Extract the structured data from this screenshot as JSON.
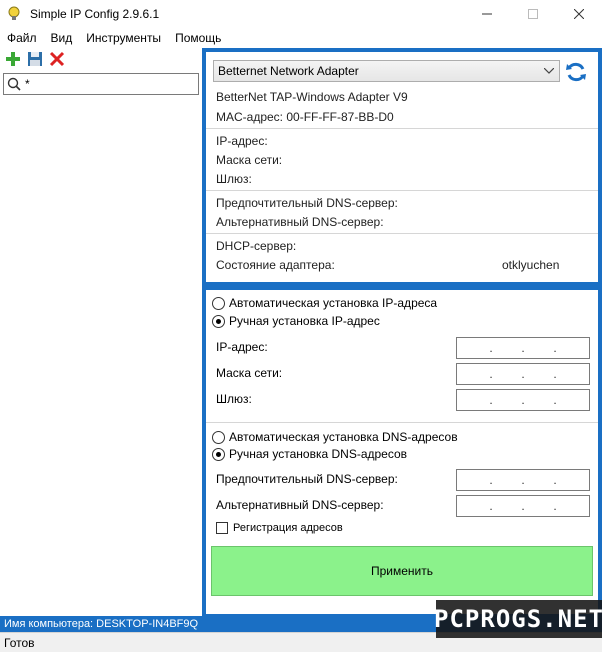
{
  "window": {
    "title": "Simple IP Config 2.9.6.1"
  },
  "menu": [
    "Файл",
    "Вид",
    "Инструменты",
    "Помощь"
  ],
  "search": {
    "value": "*"
  },
  "adapter": {
    "selected": "Betternet Network Adapter",
    "description": "BetterNet TAP-Windows Adapter V9",
    "mac": "MAC-адрес: 00-FF-FF-87-BB-D0"
  },
  "info": {
    "ip_label": "IP-адрес:",
    "mask_label": "Маска сети:",
    "gateway_label": "Шлюз:",
    "dns_pref_label": "Предпочтительный DNS-сервер:",
    "dns_alt_label": "Альтернативный DNS-сервер:",
    "dhcp_label": "DHCP-сервер:",
    "state_label": "Состояние адаптера:",
    "state_value": "otklyuchen"
  },
  "settings": {
    "auto_ip": "Автоматическая установка IP-адреса",
    "manual_ip": "Ручная установка IP-адрес",
    "ip_label": "IP-адрес:",
    "mask_label": "Маска сети:",
    "gateway_label": "Шлюз:",
    "auto_dns": "Автоматическая установка DNS-адресов",
    "manual_dns": "Ручная установка DNS-адресов",
    "dns_pref_label": "Предпочтительный DNS-сервер:",
    "dns_alt_label": "Альтернативный DNS-сервер:",
    "register_label": "Регистрация адресов",
    "apply_label": "Применить",
    "ip_dot": "."
  },
  "computer_name": "Имя компьютера: DESKTOP-IN4BF9Q",
  "status": "Готов",
  "watermark": "PCPROGS.NET",
  "colors": {
    "accent": "#1a6fc4",
    "apply": "#8bf28b"
  }
}
